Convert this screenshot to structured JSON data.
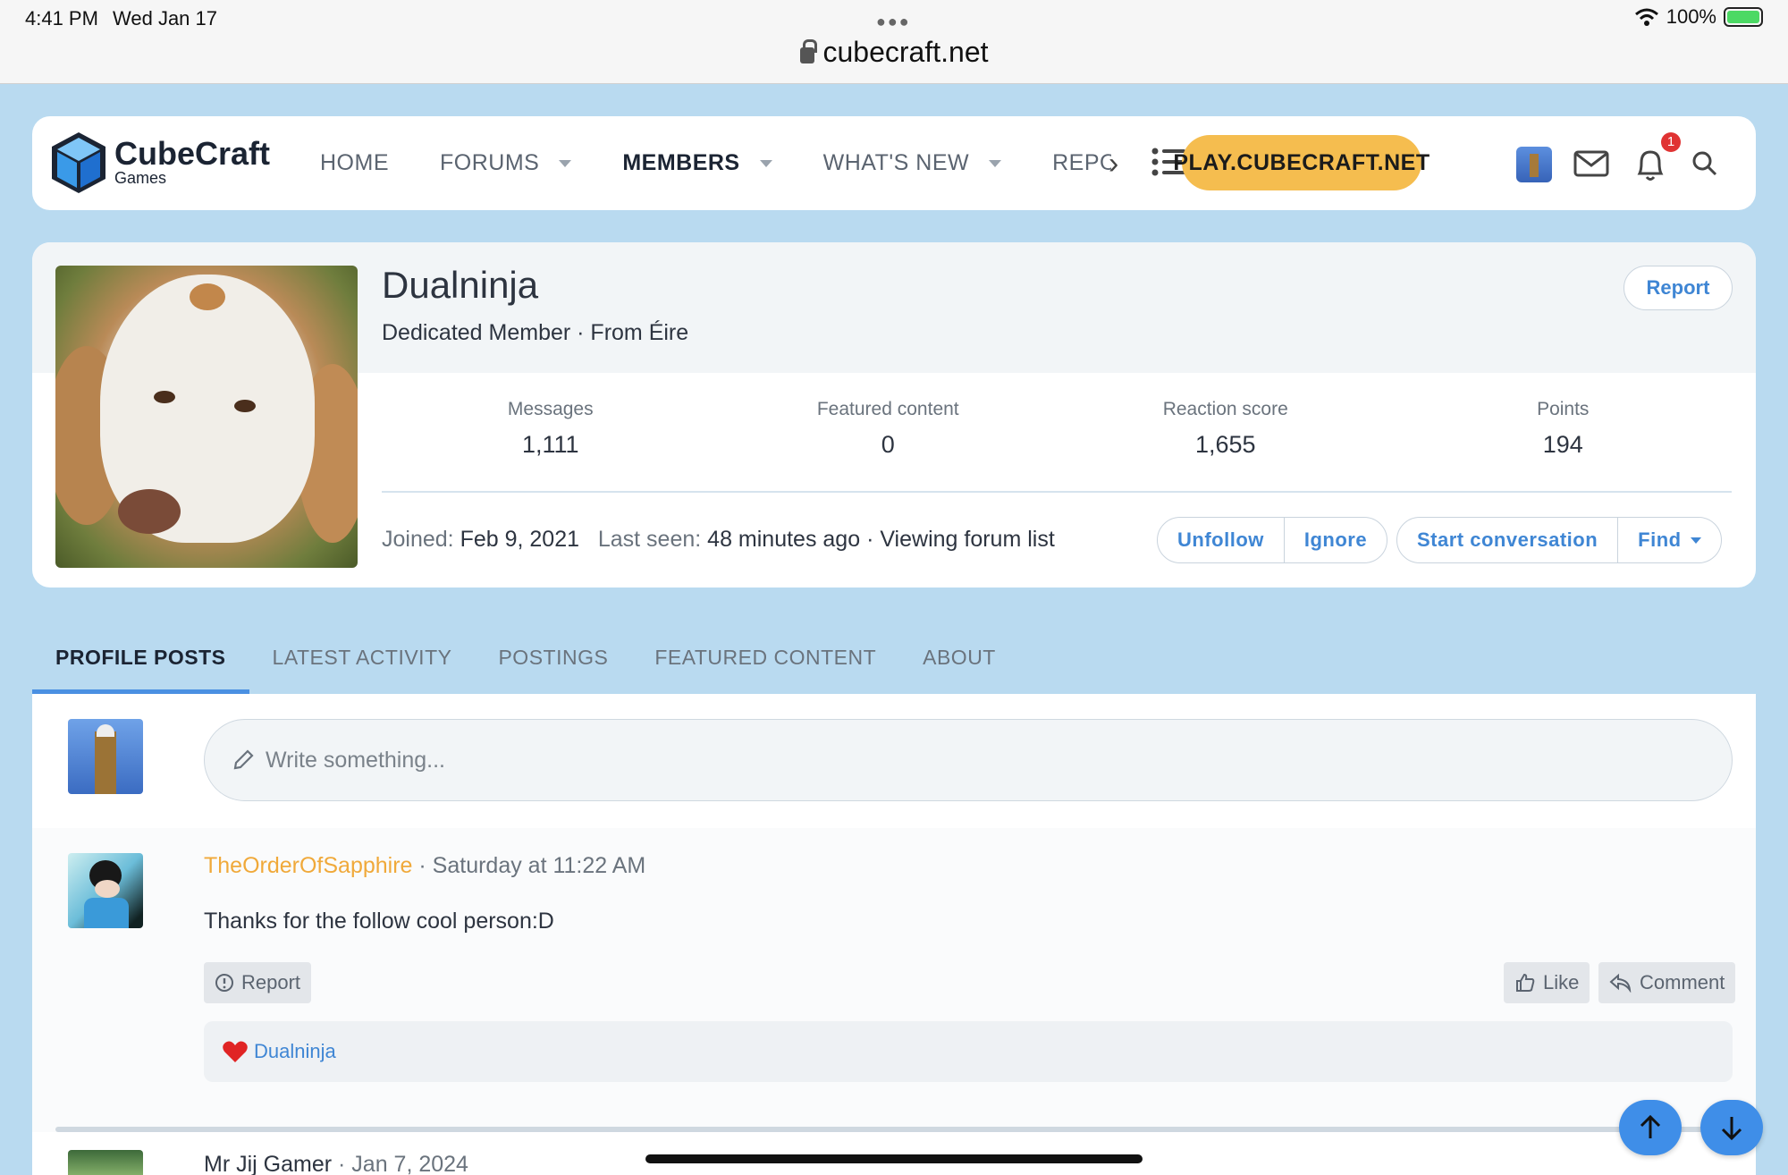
{
  "status_bar": {
    "time": "4:41 PM",
    "date": "Wed Jan 17",
    "battery": "100%"
  },
  "browser": {
    "url": "cubecraft.net"
  },
  "nav": {
    "logo_name": "CubeCraft",
    "logo_sub": "Games",
    "items": [
      {
        "label": "HOME",
        "has_caret": false
      },
      {
        "label": "FORUMS",
        "has_caret": true
      },
      {
        "label": "MEMBERS",
        "has_caret": true,
        "active": true
      },
      {
        "label": "WHAT'S NEW",
        "has_caret": true
      },
      {
        "label": "REPORTS",
        "has_caret": false
      }
    ],
    "play_label": "PLAY.CUBECRAFT.NET",
    "notification_count": "1",
    "icons": [
      "chevron-right-icon",
      "list-icon",
      "mail-icon",
      "bell-icon",
      "search-icon"
    ]
  },
  "profile": {
    "username": "Dualninja",
    "title": "Dedicated Member · From Éire",
    "report_label": "Report",
    "stats": [
      {
        "label": "Messages",
        "value": "1,111"
      },
      {
        "label": "Featured content",
        "value": "0"
      },
      {
        "label": "Reaction score",
        "value": "1,655"
      },
      {
        "label": "Points",
        "value": "194"
      }
    ],
    "joined_label": "Joined:",
    "joined_value": "Feb 9, 2021",
    "last_seen_label": "Last seen:",
    "last_seen_value": "48 minutes ago · Viewing forum list",
    "actions": {
      "unfollow": "Unfollow",
      "ignore": "Ignore",
      "start_conversation": "Start conversation",
      "find": "Find"
    }
  },
  "tabs": [
    {
      "label": "PROFILE POSTS",
      "active": true
    },
    {
      "label": "LATEST ACTIVITY"
    },
    {
      "label": "POSTINGS"
    },
    {
      "label": "FEATURED CONTENT"
    },
    {
      "label": "ABOUT"
    }
  ],
  "compose": {
    "placeholder": "Write something..."
  },
  "post": {
    "author": "TheOrderOfSapphire",
    "time": "· Saturday at 11:22 AM",
    "text": "Thanks for the follow cool person:D",
    "report": "Report",
    "like": "Like",
    "comment": "Comment",
    "reaction_user": "Dualninja"
  },
  "next_post": {
    "author": "Mr Jij Gamer",
    "time": "· Jan 7, 2024"
  },
  "colors": {
    "accent": "#3f86d4",
    "play": "#f5bd4f",
    "author": "#f0a93a",
    "page_bg": "#b9daf0"
  }
}
